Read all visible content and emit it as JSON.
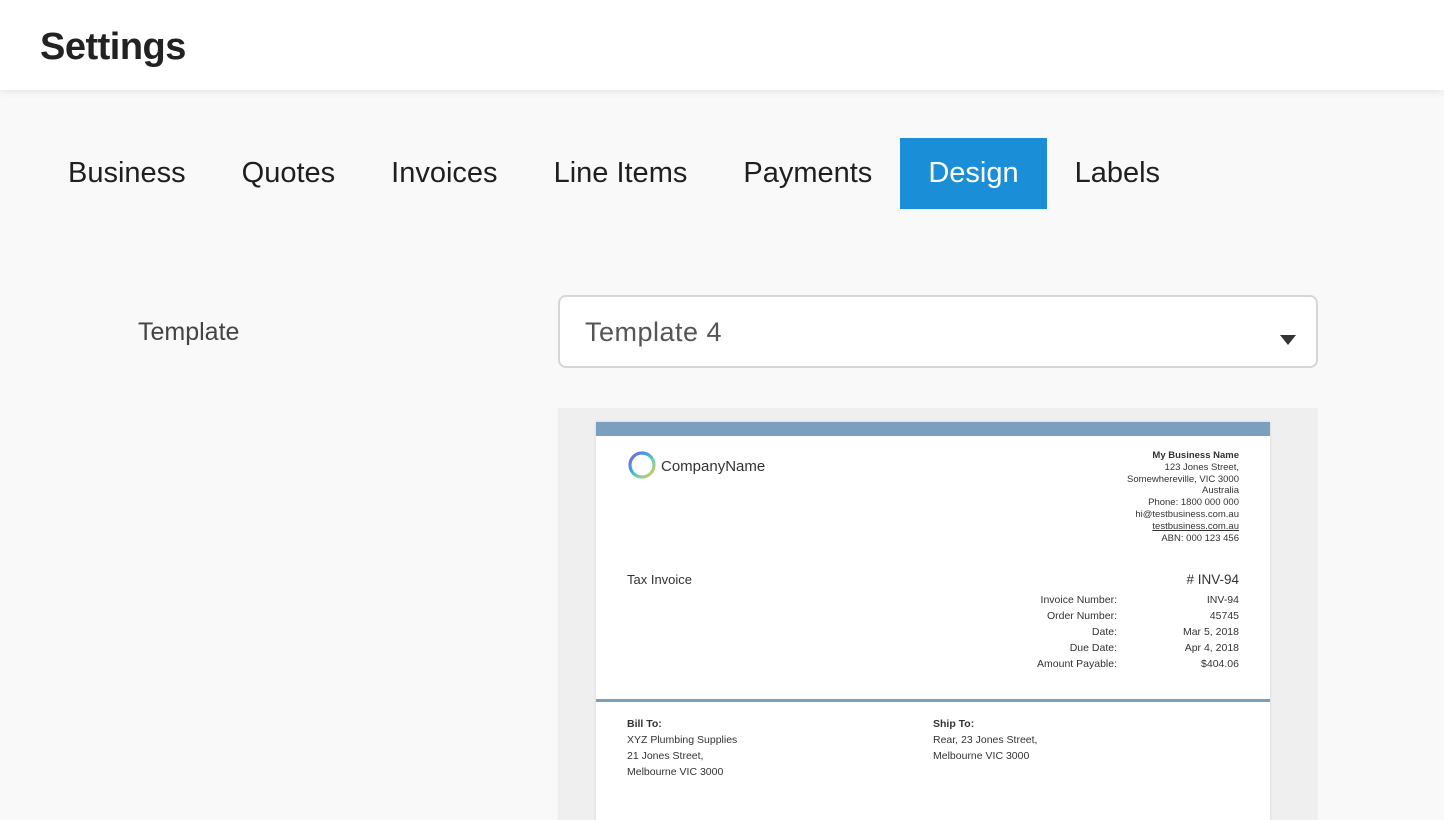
{
  "header": {
    "title": "Settings"
  },
  "tabs": [
    {
      "label": "Business"
    },
    {
      "label": "Quotes"
    },
    {
      "label": "Invoices"
    },
    {
      "label": "Line Items"
    },
    {
      "label": "Payments"
    },
    {
      "label": "Design",
      "active": true
    },
    {
      "label": "Labels"
    }
  ],
  "template_field": {
    "label": "Template",
    "selected": "Template 4"
  },
  "preview": {
    "company_name": "CompanyName",
    "business": {
      "name": "My Business Name",
      "address1": "123 Jones Street,",
      "address2": "Somewhereville, VIC 3000",
      "country": "Australia",
      "phone": "Phone: 1800 000 000",
      "email": "hi@testbusiness.com.au",
      "website": "testbusiness.com.au",
      "abn": "ABN: 000 123 456"
    },
    "doc_title": "Tax Invoice",
    "number_heading": "# INV-94",
    "meta": {
      "labels": [
        "Invoice Number:",
        "Order Number:",
        "Date:",
        "Due Date:",
        "Amount Payable:"
      ],
      "values": [
        "INV-94",
        "45745",
        "Mar 5, 2018",
        "Apr 4, 2018",
        "$404.06"
      ]
    },
    "bill_to": {
      "heading": "Bill To:",
      "lines": [
        "XYZ Plumbing Supplies",
        "21 Jones Street,",
        "Melbourne VIC 3000"
      ]
    },
    "ship_to": {
      "heading": "Ship To:",
      "lines": [
        "Rear, 23 Jones Street,",
        "Melbourne VIC 3000"
      ]
    }
  },
  "colors": {
    "accent": "#1a8ed6",
    "invoice_band": "#7ba0bf"
  }
}
